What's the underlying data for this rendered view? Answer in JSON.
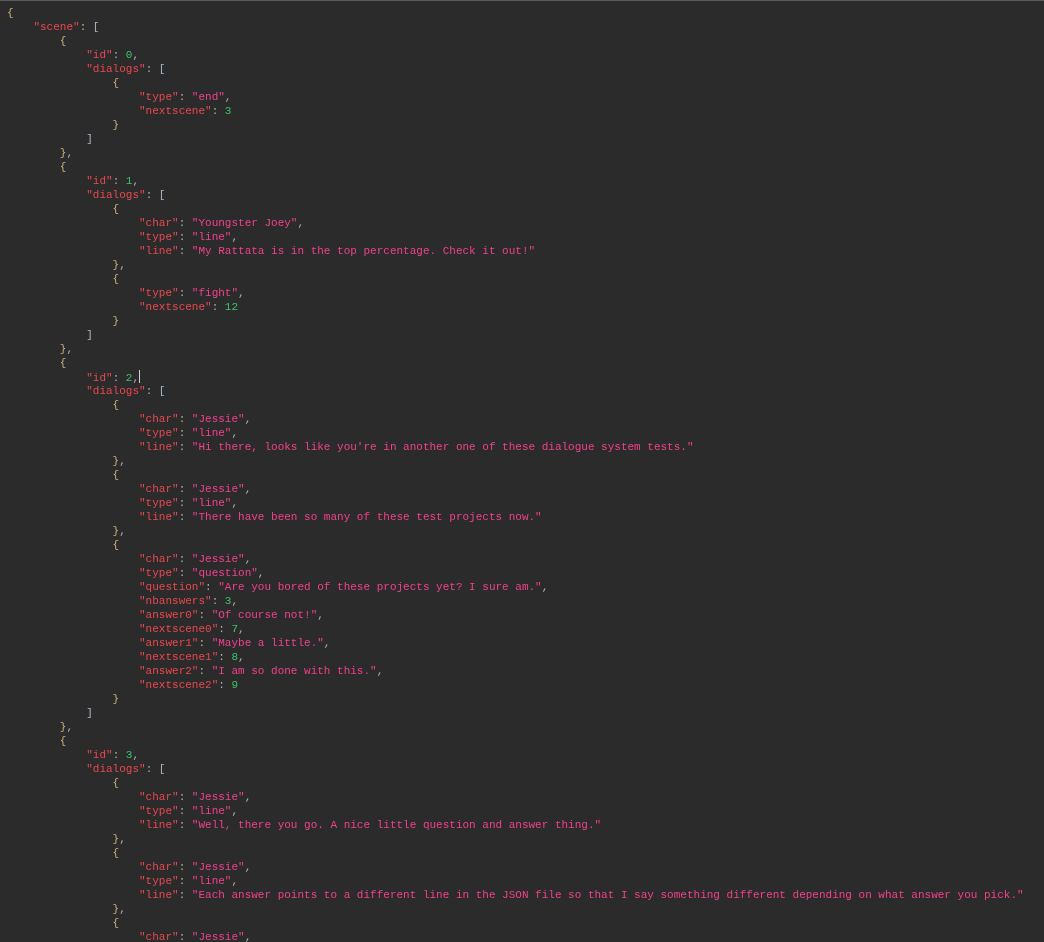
{
  "editor": {
    "lines": [
      [
        {
          "kind": "brace",
          "text": "{"
        }
      ],
      [
        {
          "kind": "key",
          "text": "    \"scene\""
        },
        {
          "kind": "punct",
          "text": ": "
        },
        {
          "kind": "bracket",
          "text": "["
        }
      ],
      [
        {
          "kind": "brace",
          "text": "        {"
        }
      ],
      [
        {
          "kind": "key",
          "text": "            \"id\""
        },
        {
          "kind": "punct",
          "text": ": "
        },
        {
          "kind": "number",
          "text": "0"
        },
        {
          "kind": "punct",
          "text": ","
        }
      ],
      [
        {
          "kind": "key",
          "text": "            \"dialogs\""
        },
        {
          "kind": "punct",
          "text": ": "
        },
        {
          "kind": "bracket",
          "text": "["
        }
      ],
      [
        {
          "kind": "brace",
          "text": "                {"
        }
      ],
      [
        {
          "kind": "key",
          "text": "                    \"type\""
        },
        {
          "kind": "punct",
          "text": ": "
        },
        {
          "kind": "string",
          "text": "\"end\""
        },
        {
          "kind": "punct",
          "text": ","
        }
      ],
      [
        {
          "kind": "key",
          "text": "                    \"nextscene\""
        },
        {
          "kind": "punct",
          "text": ": "
        },
        {
          "kind": "number",
          "text": "3"
        }
      ],
      [
        {
          "kind": "brace",
          "text": "                }"
        }
      ],
      [
        {
          "kind": "bracket",
          "text": "            ]"
        }
      ],
      [
        {
          "kind": "brace",
          "text": "        }"
        },
        {
          "kind": "punct",
          "text": ","
        }
      ],
      [
        {
          "kind": "brace",
          "text": "        {"
        }
      ],
      [
        {
          "kind": "key",
          "text": "            \"id\""
        },
        {
          "kind": "punct",
          "text": ": "
        },
        {
          "kind": "number",
          "text": "1"
        },
        {
          "kind": "punct",
          "text": ","
        }
      ],
      [
        {
          "kind": "key",
          "text": "            \"dialogs\""
        },
        {
          "kind": "punct",
          "text": ": "
        },
        {
          "kind": "bracket",
          "text": "["
        }
      ],
      [
        {
          "kind": "brace",
          "text": "                {"
        }
      ],
      [
        {
          "kind": "key",
          "text": "                    \"char\""
        },
        {
          "kind": "punct",
          "text": ": "
        },
        {
          "kind": "string",
          "text": "\"Youngster Joey\""
        },
        {
          "kind": "punct",
          "text": ","
        }
      ],
      [
        {
          "kind": "key",
          "text": "                    \"type\""
        },
        {
          "kind": "punct",
          "text": ": "
        },
        {
          "kind": "string",
          "text": "\"line\""
        },
        {
          "kind": "punct",
          "text": ","
        }
      ],
      [
        {
          "kind": "key",
          "text": "                    \"line\""
        },
        {
          "kind": "punct",
          "text": ": "
        },
        {
          "kind": "string",
          "text": "\"My Rattata is in the top percentage. Check it out!\""
        }
      ],
      [
        {
          "kind": "brace",
          "text": "                }"
        },
        {
          "kind": "punct",
          "text": ","
        }
      ],
      [
        {
          "kind": "brace",
          "text": "                {"
        }
      ],
      [
        {
          "kind": "key",
          "text": "                    \"type\""
        },
        {
          "kind": "punct",
          "text": ": "
        },
        {
          "kind": "string",
          "text": "\"fight\""
        },
        {
          "kind": "punct",
          "text": ","
        }
      ],
      [
        {
          "kind": "key",
          "text": "                    \"nextscene\""
        },
        {
          "kind": "punct",
          "text": ": "
        },
        {
          "kind": "number",
          "text": "12"
        }
      ],
      [
        {
          "kind": "brace",
          "text": "                }"
        }
      ],
      [
        {
          "kind": "bracket",
          "text": "            ]"
        }
      ],
      [
        {
          "kind": "brace",
          "text": "        }"
        },
        {
          "kind": "punct",
          "text": ","
        }
      ],
      [
        {
          "kind": "brace",
          "text": "        {"
        }
      ],
      [
        {
          "kind": "key",
          "text": "            \"id\""
        },
        {
          "kind": "punct",
          "text": ": "
        },
        {
          "kind": "number",
          "text": "2"
        },
        {
          "kind": "punct",
          "text": ","
        },
        {
          "kind": "caret"
        }
      ],
      [
        {
          "kind": "key",
          "text": "            \"dialogs\""
        },
        {
          "kind": "punct",
          "text": ": "
        },
        {
          "kind": "bracket",
          "text": "["
        }
      ],
      [
        {
          "kind": "brace",
          "text": "                {"
        }
      ],
      [
        {
          "kind": "key",
          "text": "                    \"char\""
        },
        {
          "kind": "punct",
          "text": ": "
        },
        {
          "kind": "string",
          "text": "\"Jessie\""
        },
        {
          "kind": "punct",
          "text": ","
        }
      ],
      [
        {
          "kind": "key",
          "text": "                    \"type\""
        },
        {
          "kind": "punct",
          "text": ": "
        },
        {
          "kind": "string",
          "text": "\"line\""
        },
        {
          "kind": "punct",
          "text": ","
        }
      ],
      [
        {
          "kind": "key",
          "text": "                    \"line\""
        },
        {
          "kind": "punct",
          "text": ": "
        },
        {
          "kind": "string",
          "text": "\"Hi there, looks like you're in another one of these dialogue system tests.\""
        }
      ],
      [
        {
          "kind": "brace",
          "text": "                }"
        },
        {
          "kind": "punct",
          "text": ","
        }
      ],
      [
        {
          "kind": "brace",
          "text": "                {"
        }
      ],
      [
        {
          "kind": "key",
          "text": "                    \"char\""
        },
        {
          "kind": "punct",
          "text": ": "
        },
        {
          "kind": "string",
          "text": "\"Jessie\""
        },
        {
          "kind": "punct",
          "text": ","
        }
      ],
      [
        {
          "kind": "key",
          "text": "                    \"type\""
        },
        {
          "kind": "punct",
          "text": ": "
        },
        {
          "kind": "string",
          "text": "\"line\""
        },
        {
          "kind": "punct",
          "text": ","
        }
      ],
      [
        {
          "kind": "key",
          "text": "                    \"line\""
        },
        {
          "kind": "punct",
          "text": ": "
        },
        {
          "kind": "string",
          "text": "\"There have been so many of these test projects now.\""
        }
      ],
      [
        {
          "kind": "brace",
          "text": "                }"
        },
        {
          "kind": "punct",
          "text": ","
        }
      ],
      [
        {
          "kind": "brace",
          "text": "                {"
        }
      ],
      [
        {
          "kind": "key",
          "text": "                    \"char\""
        },
        {
          "kind": "punct",
          "text": ": "
        },
        {
          "kind": "string",
          "text": "\"Jessie\""
        },
        {
          "kind": "punct",
          "text": ","
        }
      ],
      [
        {
          "kind": "key",
          "text": "                    \"type\""
        },
        {
          "kind": "punct",
          "text": ": "
        },
        {
          "kind": "string",
          "text": "\"question\""
        },
        {
          "kind": "punct",
          "text": ","
        }
      ],
      [
        {
          "kind": "key",
          "text": "                    \"question\""
        },
        {
          "kind": "punct",
          "text": ": "
        },
        {
          "kind": "string",
          "text": "\"Are you bored of these projects yet? I sure am.\""
        },
        {
          "kind": "punct",
          "text": ","
        }
      ],
      [
        {
          "kind": "key",
          "text": "                    \"nbanswers\""
        },
        {
          "kind": "punct",
          "text": ": "
        },
        {
          "kind": "number",
          "text": "3"
        },
        {
          "kind": "punct",
          "text": ","
        }
      ],
      [
        {
          "kind": "key",
          "text": "                    \"answer0\""
        },
        {
          "kind": "punct",
          "text": ": "
        },
        {
          "kind": "string",
          "text": "\"Of course not!\""
        },
        {
          "kind": "punct",
          "text": ","
        }
      ],
      [
        {
          "kind": "key",
          "text": "                    \"nextscene0\""
        },
        {
          "kind": "punct",
          "text": ": "
        },
        {
          "kind": "number",
          "text": "7"
        },
        {
          "kind": "punct",
          "text": ","
        }
      ],
      [
        {
          "kind": "key",
          "text": "                    \"answer1\""
        },
        {
          "kind": "punct",
          "text": ": "
        },
        {
          "kind": "string",
          "text": "\"Maybe a little.\""
        },
        {
          "kind": "punct",
          "text": ","
        }
      ],
      [
        {
          "kind": "key",
          "text": "                    \"nextscene1\""
        },
        {
          "kind": "punct",
          "text": ": "
        },
        {
          "kind": "number",
          "text": "8"
        },
        {
          "kind": "punct",
          "text": ","
        }
      ],
      [
        {
          "kind": "key",
          "text": "                    \"answer2\""
        },
        {
          "kind": "punct",
          "text": ": "
        },
        {
          "kind": "string",
          "text": "\"I am so done with this.\""
        },
        {
          "kind": "punct",
          "text": ","
        }
      ],
      [
        {
          "kind": "key",
          "text": "                    \"nextscene2\""
        },
        {
          "kind": "punct",
          "text": ": "
        },
        {
          "kind": "number",
          "text": "9"
        }
      ],
      [
        {
          "kind": "brace",
          "text": "                }"
        }
      ],
      [
        {
          "kind": "bracket",
          "text": "            ]"
        }
      ],
      [
        {
          "kind": "brace",
          "text": "        }"
        },
        {
          "kind": "punct",
          "text": ","
        }
      ],
      [
        {
          "kind": "brace",
          "text": "        {"
        }
      ],
      [
        {
          "kind": "key",
          "text": "            \"id\""
        },
        {
          "kind": "punct",
          "text": ": "
        },
        {
          "kind": "number",
          "text": "3"
        },
        {
          "kind": "punct",
          "text": ","
        }
      ],
      [
        {
          "kind": "key",
          "text": "            \"dialogs\""
        },
        {
          "kind": "punct",
          "text": ": "
        },
        {
          "kind": "bracket",
          "text": "["
        }
      ],
      [
        {
          "kind": "brace",
          "text": "                {"
        }
      ],
      [
        {
          "kind": "key",
          "text": "                    \"char\""
        },
        {
          "kind": "punct",
          "text": ": "
        },
        {
          "kind": "string",
          "text": "\"Jessie\""
        },
        {
          "kind": "punct",
          "text": ","
        }
      ],
      [
        {
          "kind": "key",
          "text": "                    \"type\""
        },
        {
          "kind": "punct",
          "text": ": "
        },
        {
          "kind": "string",
          "text": "\"line\""
        },
        {
          "kind": "punct",
          "text": ","
        }
      ],
      [
        {
          "kind": "key",
          "text": "                    \"line\""
        },
        {
          "kind": "punct",
          "text": ": "
        },
        {
          "kind": "string",
          "text": "\"Well, there you go. A nice little question and answer thing.\""
        }
      ],
      [
        {
          "kind": "brace",
          "text": "                }"
        },
        {
          "kind": "punct",
          "text": ","
        }
      ],
      [
        {
          "kind": "brace",
          "text": "                {"
        }
      ],
      [
        {
          "kind": "key",
          "text": "                    \"char\""
        },
        {
          "kind": "punct",
          "text": ": "
        },
        {
          "kind": "string",
          "text": "\"Jessie\""
        },
        {
          "kind": "punct",
          "text": ","
        }
      ],
      [
        {
          "kind": "key",
          "text": "                    \"type\""
        },
        {
          "kind": "punct",
          "text": ": "
        },
        {
          "kind": "string",
          "text": "\"line\""
        },
        {
          "kind": "punct",
          "text": ","
        }
      ],
      [
        {
          "kind": "key",
          "text": "                    \"line\""
        },
        {
          "kind": "punct",
          "text": ": "
        },
        {
          "kind": "string",
          "text": "\"Each answer points to a different line in the JSON file so that I say something different depending on what answer you pick.\""
        }
      ],
      [
        {
          "kind": "brace",
          "text": "                }"
        },
        {
          "kind": "punct",
          "text": ","
        }
      ],
      [
        {
          "kind": "brace",
          "text": "                {"
        }
      ],
      [
        {
          "kind": "key",
          "text": "                    \"char\""
        },
        {
          "kind": "punct",
          "text": ": "
        },
        {
          "kind": "string",
          "text": "\"Jessie\""
        },
        {
          "kind": "punct",
          "text": ","
        }
      ]
    ]
  }
}
